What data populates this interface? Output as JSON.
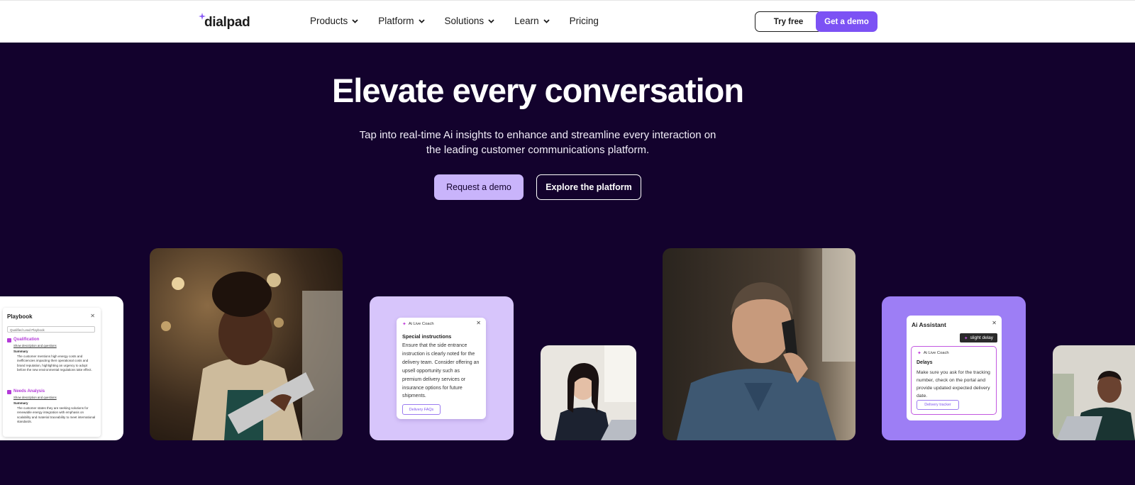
{
  "nav": {
    "logo": "dialpad",
    "menu": [
      {
        "label": "Products",
        "has_dropdown": true
      },
      {
        "label": "Platform",
        "has_dropdown": true
      },
      {
        "label": "Solutions",
        "has_dropdown": true
      },
      {
        "label": "Learn",
        "has_dropdown": true
      },
      {
        "label": "Pricing",
        "has_dropdown": false
      }
    ],
    "try_free": "Try free",
    "get_demo": "Get a demo"
  },
  "hero": {
    "title": "Elevate every conversation",
    "subtitle": "Tap into real-time Ai insights to enhance and streamline every interaction on the leading customer communications platform.",
    "cta_primary": "Request a demo",
    "cta_secondary": "Explore the platform"
  },
  "playbook": {
    "title": "Playbook",
    "select_value": "Qualified Lead Playbook",
    "sections": [
      {
        "name": "Qualification",
        "link": "Show description and questions",
        "summary_label": "Summary",
        "summary": "The customer mentions high energy costs and inefficiencies impacting their operational costs and brand reputation, highlighting an urgency to adopt before the new environmental regulations take effect."
      },
      {
        "name": "Needs Analysis",
        "link": "Show description and questions",
        "summary_label": "Summary",
        "summary": "The customer states they are seeking solutions for renewable energy integration with emphasis on scalability and material traceability to meet international standards."
      }
    ]
  },
  "live_coach": {
    "tag": "Ai Live Coach",
    "heading": "Special instructions",
    "body": "Ensure that the side entrance instruction is clearly noted for the delivery team. Consider offering an upsell opportunity such as premium delivery services or insurance options for future shipments.",
    "button": "Delivery FAQs"
  },
  "assistant": {
    "title": "Ai Assistant",
    "delay_badge": "slight delay",
    "coach_tag": "Ai Live Coach",
    "heading": "Delays",
    "body": "Make sure you ask for the tracking number, check on the portal and provide updated expected delivery date.",
    "button": "Delivery tracker"
  },
  "colors": {
    "background": "#13022d",
    "brand_purple": "#7c52f4",
    "light_purple": "#c9b4fb",
    "card_lavender": "#d7c5fb",
    "card_violet": "#9d7ef5",
    "accent_magenta": "#b33ad8"
  }
}
